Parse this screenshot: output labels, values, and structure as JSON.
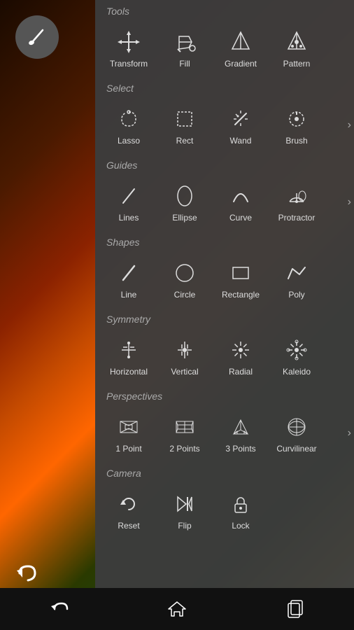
{
  "brush_button": "✏",
  "undo_button": "↩",
  "sections": [
    {
      "label": "Tools",
      "items": [
        {
          "id": "transform",
          "label": "Transform"
        },
        {
          "id": "fill",
          "label": "Fill"
        },
        {
          "id": "gradient",
          "label": "Gradient"
        },
        {
          "id": "pattern",
          "label": "Pattern"
        }
      ],
      "has_arrow": false
    },
    {
      "label": "Select",
      "items": [
        {
          "id": "lasso",
          "label": "Lasso"
        },
        {
          "id": "rect",
          "label": "Rect"
        },
        {
          "id": "wand",
          "label": "Wand"
        },
        {
          "id": "brush",
          "label": "Brush"
        }
      ],
      "has_arrow": true
    },
    {
      "label": "Guides",
      "items": [
        {
          "id": "lines",
          "label": "Lines"
        },
        {
          "id": "ellipse",
          "label": "Ellipse"
        },
        {
          "id": "curve",
          "label": "Curve"
        },
        {
          "id": "protractor",
          "label": "Protractor"
        }
      ],
      "has_arrow": true
    },
    {
      "label": "Shapes",
      "items": [
        {
          "id": "line",
          "label": "Line"
        },
        {
          "id": "circle",
          "label": "Circle"
        },
        {
          "id": "rectangle",
          "label": "Rectangle"
        },
        {
          "id": "poly",
          "label": "Poly"
        }
      ],
      "has_arrow": false
    },
    {
      "label": "Symmetry",
      "items": [
        {
          "id": "horizontal",
          "label": "Horizontal"
        },
        {
          "id": "vertical",
          "label": "Vertical"
        },
        {
          "id": "radial",
          "label": "Radial"
        },
        {
          "id": "kaleido",
          "label": "Kaleido"
        }
      ],
      "has_arrow": false
    },
    {
      "label": "Perspectives",
      "items": [
        {
          "id": "1point",
          "label": "1 Point"
        },
        {
          "id": "2points",
          "label": "2 Points"
        },
        {
          "id": "3points",
          "label": "3 Points"
        },
        {
          "id": "curvilinear",
          "label": "Curvilinear"
        }
      ],
      "has_arrow": true
    },
    {
      "label": "Camera",
      "items": [
        {
          "id": "reset",
          "label": "Reset"
        },
        {
          "id": "flip",
          "label": "Flip"
        },
        {
          "id": "lock",
          "label": "Lock"
        }
      ],
      "has_arrow": false
    }
  ],
  "nav": {
    "back": "↩",
    "home": "⌂",
    "recent": "▣"
  }
}
